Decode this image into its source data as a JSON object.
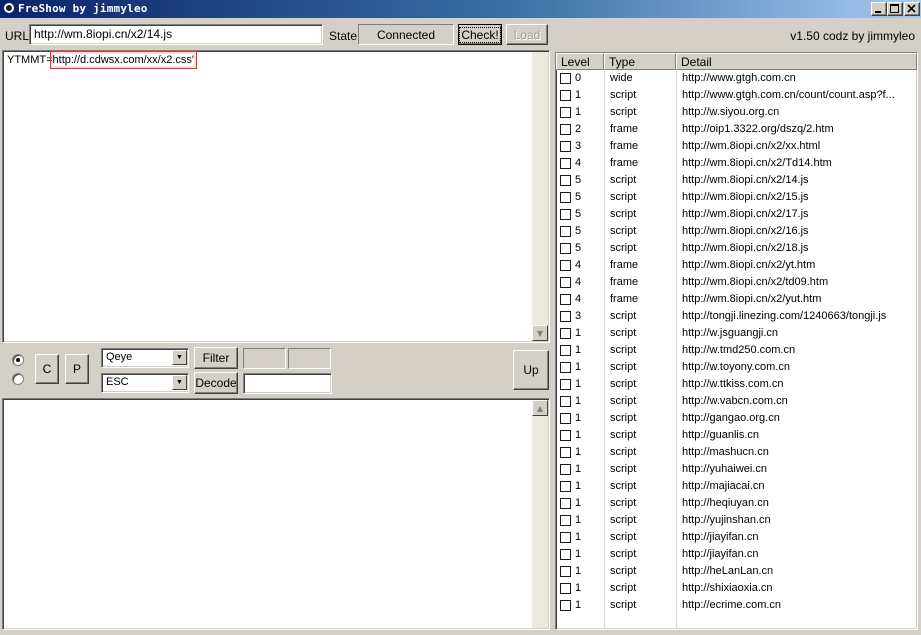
{
  "window": {
    "title": "FreShow by jimmyleo",
    "version_text": "v1.50 codz by jimmyleo"
  },
  "toolbar": {
    "url_label": "URL",
    "url_value": "http://wm.8iopi.cn/x2/14.js",
    "state_label": "State",
    "state_value": "Connected",
    "check_label": "Check!",
    "load_label": "Load"
  },
  "source_pane": {
    "prefix": "YTMMT=",
    "highlighted": "http://d.cdwsx.com/xx/x2.css",
    "suffix": "'"
  },
  "controls": {
    "c_button": "C",
    "p_button": "P",
    "combo1_value": "Qeye",
    "combo2_value": "ESC",
    "filter_label": "Filter",
    "decode_label": "Decode",
    "up_label": "Up",
    "radio1_checked": true,
    "radio2_checked": false
  },
  "list": {
    "headers": [
      "Level",
      "Type",
      "Detail"
    ],
    "rows": [
      {
        "level": "0",
        "type": "wide",
        "detail": "http://www.gtgh.com.cn"
      },
      {
        "level": "1",
        "type": "script",
        "detail": "http://www.gtgh.com.cn/count/count.asp?f..."
      },
      {
        "level": "1",
        "type": "script",
        "detail": "http://w.siyou.org.cn"
      },
      {
        "level": "2",
        "type": "frame",
        "detail": "http://oip1.3322.org/dszq/2.htm"
      },
      {
        "level": "3",
        "type": "frame",
        "detail": "http://wm.8iopi.cn/x2/xx.html"
      },
      {
        "level": "4",
        "type": "frame",
        "detail": "http://wm.8iopi.cn/x2/Td14.htm"
      },
      {
        "level": "5",
        "type": "script",
        "detail": "http://wm.8iopi.cn/x2/14.js"
      },
      {
        "level": "5",
        "type": "script",
        "detail": "http://wm.8iopi.cn/x2/15.js"
      },
      {
        "level": "5",
        "type": "script",
        "detail": "http://wm.8iopi.cn/x2/17.js"
      },
      {
        "level": "5",
        "type": "script",
        "detail": "http://wm.8iopi.cn/x2/16.js"
      },
      {
        "level": "5",
        "type": "script",
        "detail": "http://wm.8iopi.cn/x2/18.js"
      },
      {
        "level": "4",
        "type": "frame",
        "detail": "http://wm.8iopi.cn/x2/yt.htm"
      },
      {
        "level": "4",
        "type": "frame",
        "detail": "http://wm.8iopi.cn/x2/td09.htm"
      },
      {
        "level": "4",
        "type": "frame",
        "detail": "http://wm.8iopi.cn/x2/yut.htm"
      },
      {
        "level": "3",
        "type": "script",
        "detail": "http://tongji.linezing.com/1240663/tongji.js"
      },
      {
        "level": "1",
        "type": "script",
        "detail": "http://w.jsguangji.cn"
      },
      {
        "level": "1",
        "type": "script",
        "detail": "http://w.tmd250.com.cn"
      },
      {
        "level": "1",
        "type": "script",
        "detail": "http://w.toyony.com.cn"
      },
      {
        "level": "1",
        "type": "script",
        "detail": "http://w.ttkiss.com.cn"
      },
      {
        "level": "1",
        "type": "script",
        "detail": "http://w.vabcn.com.cn"
      },
      {
        "level": "1",
        "type": "script",
        "detail": "http://gangao.org.cn"
      },
      {
        "level": "1",
        "type": "script",
        "detail": "http://guanlis.cn"
      },
      {
        "level": "1",
        "type": "script",
        "detail": "http://mashucn.cn"
      },
      {
        "level": "1",
        "type": "script",
        "detail": "http://yuhaiwei.cn"
      },
      {
        "level": "1",
        "type": "script",
        "detail": "http://majiacai.cn"
      },
      {
        "level": "1",
        "type": "script",
        "detail": "http://heqiuyan.cn"
      },
      {
        "level": "1",
        "type": "script",
        "detail": "http://yujinshan.cn"
      },
      {
        "level": "1",
        "type": "script",
        "detail": "http://jiayifan.cn"
      },
      {
        "level": "1",
        "type": "script",
        "detail": "http://jiayifan.cn"
      },
      {
        "level": "1",
        "type": "script",
        "detail": "http://heLanLan.cn"
      },
      {
        "level": "1",
        "type": "script",
        "detail": "http://shixiaoxia.cn"
      },
      {
        "level": "1",
        "type": "script",
        "detail": "http://ecrime.com.cn"
      }
    ]
  },
  "icons": {
    "app": "app-icon",
    "minimize": "minimize-icon",
    "maximize": "maximize-icon",
    "close": "close-icon",
    "scroll_up": "arrow-up-icon",
    "scroll_down": "arrow-down-icon",
    "combo_arrow": "chevron-down-icon"
  },
  "colors": {
    "titlebar_start": "#0a246a",
    "titlebar_end": "#a6caf0",
    "highlight_box": "#e03030",
    "window_bg": "#d4d0c8"
  }
}
